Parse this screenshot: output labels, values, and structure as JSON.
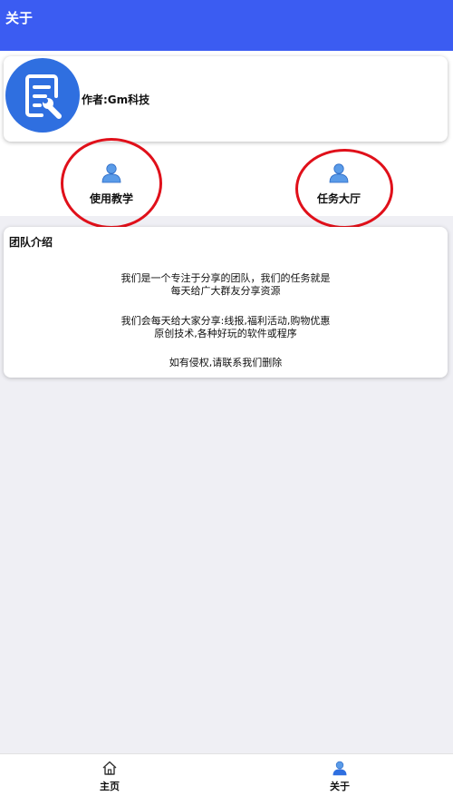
{
  "header": {
    "title": "关于"
  },
  "author_card": {
    "logo_icon": "document-wrench-icon",
    "author_text": "作者:Gm科技"
  },
  "shortcuts": [
    {
      "label": "使用教学",
      "icon": "person-icon"
    },
    {
      "label": "任务大厅",
      "icon": "person-icon"
    }
  ],
  "team": {
    "title": "团队介绍",
    "lines": [
      "我们是一个专注于分享的团队，我们的任务就是",
      "每天给广大群友分享资源",
      "我们会每天给大家分享:线报,福利活动,购物优惠",
      "原创技术,各种好玩的软件或程序",
      "如有侵权,请联系我们删除"
    ]
  },
  "tabbar": {
    "items": [
      {
        "label": "主页",
        "icon": "home-icon"
      },
      {
        "label": "关于",
        "icon": "person-icon"
      }
    ]
  },
  "colors": {
    "header": "#3b5cf2",
    "accent_blue": "#2f6fe0",
    "annotation_red": "#e0101a",
    "background": "#efeff4"
  }
}
